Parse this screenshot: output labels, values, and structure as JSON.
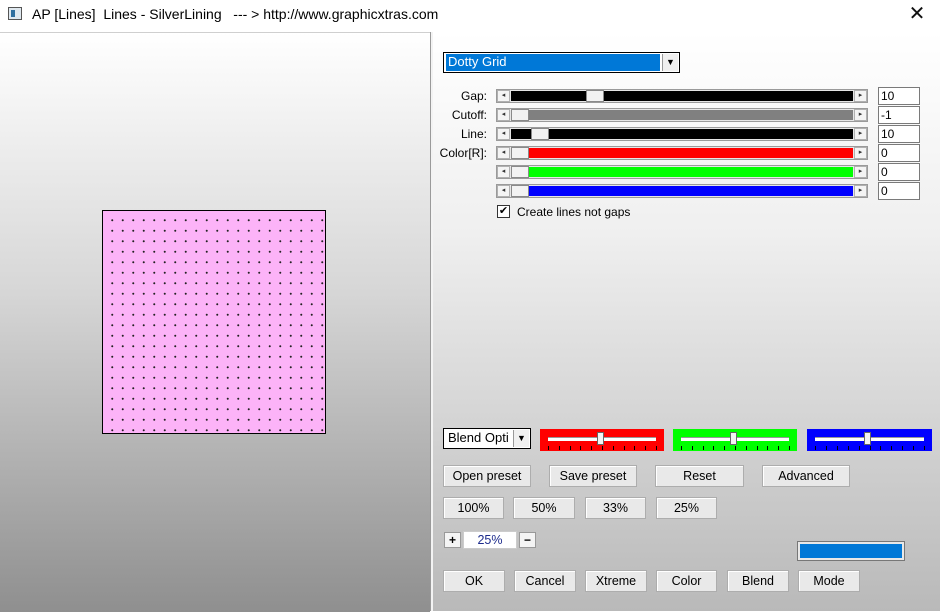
{
  "window": {
    "title": "AP [Lines]  Lines - SilverLining   --- > http://www.graphicxtras.com",
    "close_glyph": "✕"
  },
  "preset": {
    "selected": "Dotty Grid"
  },
  "sliders": [
    {
      "label": "Gap:",
      "value": "10",
      "fraction": 0.23,
      "fill_color": "#000000"
    },
    {
      "label": "Cutoff:",
      "value": "-1",
      "fraction": 0.0,
      "fill_color": "#808080"
    },
    {
      "label": "Line:",
      "value": "10",
      "fraction": 0.06,
      "fill_color": "#000000"
    },
    {
      "label": "Color[R]:",
      "value": "0",
      "fraction": 0.0,
      "fill_color": "#ff0000"
    },
    {
      "label": "",
      "value": "0",
      "fraction": 0.0,
      "fill_color": "#00ff00"
    },
    {
      "label": "",
      "value": "0",
      "fraction": 0.0,
      "fill_color": "#0000ff"
    }
  ],
  "checkbox": {
    "label": "Create lines not gaps",
    "checked": true,
    "mark": "✔"
  },
  "blend": {
    "selected": "Blend Opti"
  },
  "color_sliders": [
    {
      "color": "#ff0000",
      "fraction": 0.48
    },
    {
      "color": "#00ff00",
      "fraction": 0.48
    },
    {
      "color": "#0000ff",
      "fraction": 0.48
    }
  ],
  "buttons_row1": [
    "Open preset",
    "Save preset",
    "Reset",
    "Advanced"
  ],
  "buttons_zoom": [
    "100%",
    "50%",
    "33%",
    "25%"
  ],
  "zoom": {
    "plus": "+",
    "minus": "−",
    "value": "25%"
  },
  "buttons_bottom": [
    "OK",
    "Cancel",
    "Xtreme",
    "Color",
    "Blend",
    "Mode"
  ],
  "swatch_color": "#0078d7",
  "preview": {
    "fill_color": "#fcb3f8"
  }
}
